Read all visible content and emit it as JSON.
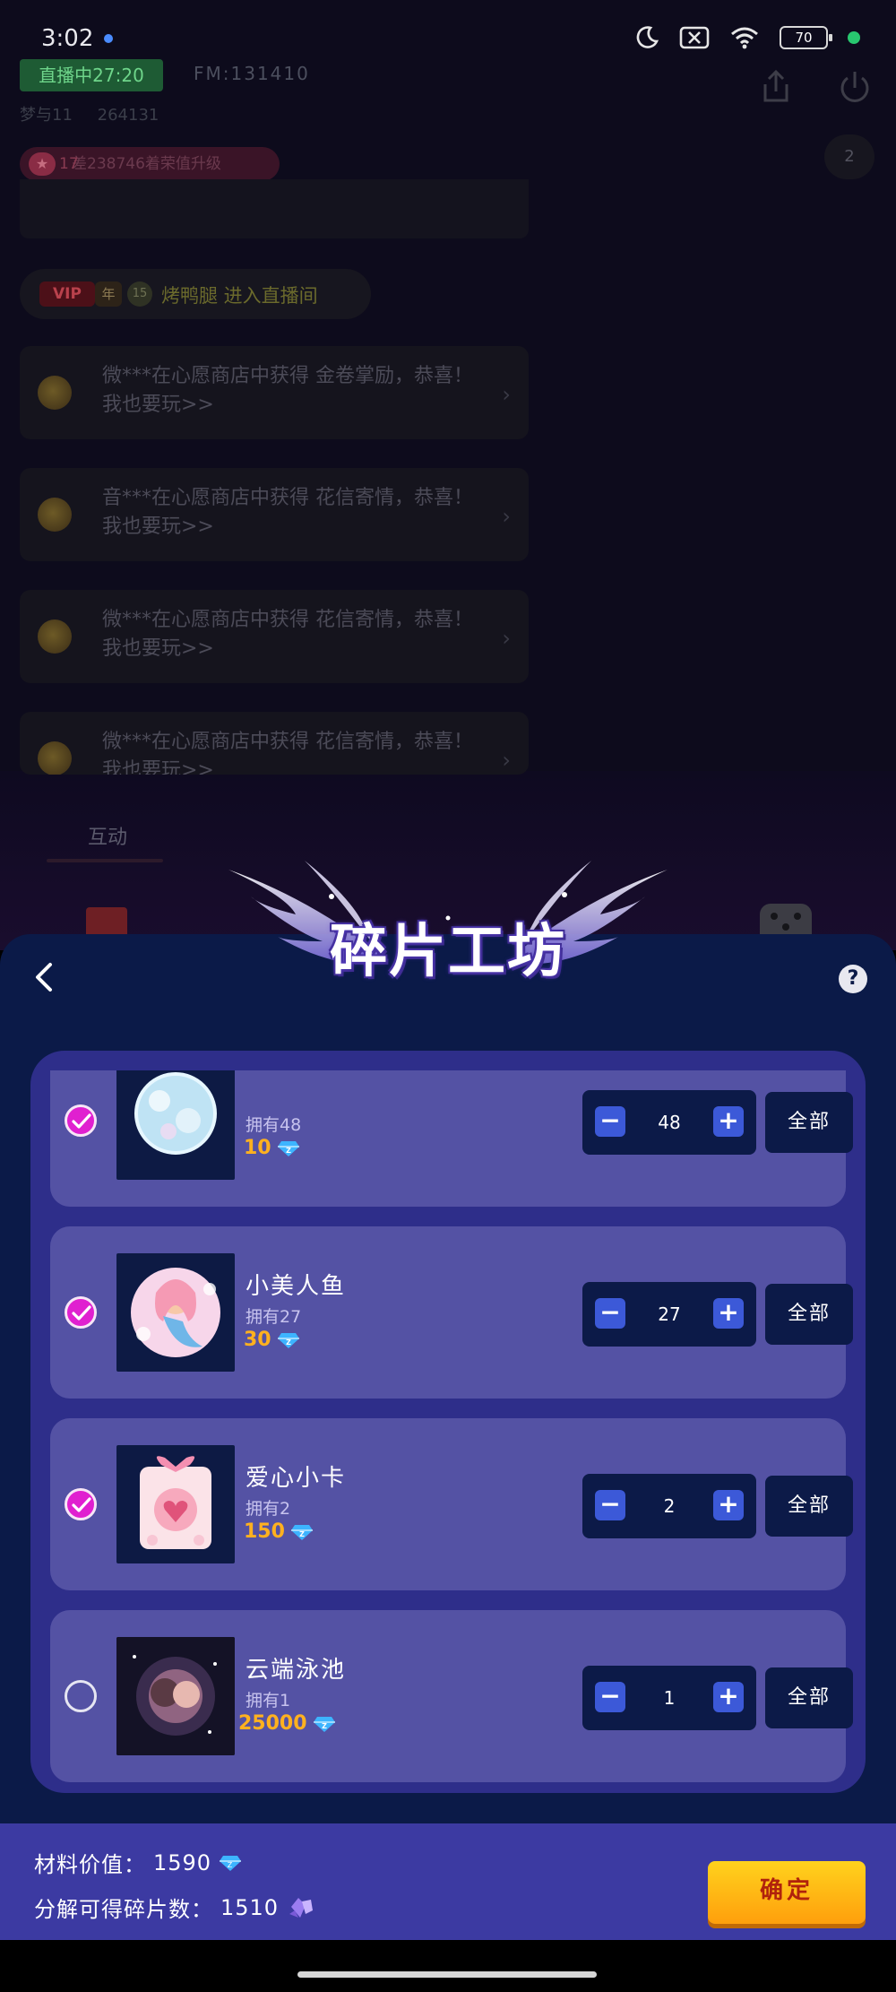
{
  "status_bar": {
    "time": "3:02",
    "battery": "70"
  },
  "room": {
    "live_badge": "直播中27:20",
    "fm": "FM:131410",
    "stats": [
      "梦与11",
      "264131"
    ],
    "share_icon": "share-icon",
    "power_icon": "power-icon",
    "viewer_count": "2",
    "rank_level": "17",
    "rank_text": "差238746着荣值升级",
    "vip_tag": "VIP",
    "vip_year": "年",
    "vip_level": "15",
    "vip_enter": "烤鸭腿 进入直播间",
    "messages": [
      "微***在心愿商店中获得 金卷掌励，恭喜！我也要玩>>",
      "音***在心愿商店中获得 花信寄情，恭喜！我也要玩>>",
      "微***在心愿商店中获得 花信寄情，恭喜！我也要玩>>",
      "微***在心愿商店中获得 花信寄情，恭喜！我也要玩>>"
    ],
    "interact_label": "互动"
  },
  "sheet": {
    "title": "碎片工坊",
    "help": "?",
    "items": [
      {
        "name": "",
        "owned": "拥有48",
        "price": "10",
        "qty": "48",
        "checked": true
      },
      {
        "name": "小美人鱼",
        "owned": "拥有27",
        "price": "30",
        "qty": "27",
        "checked": true
      },
      {
        "name": "爱心小卡",
        "owned": "拥有2",
        "price": "150",
        "qty": "2",
        "checked": true
      },
      {
        "name": "云端泳池",
        "owned": "拥有1",
        "price": "25000",
        "qty": "1",
        "checked": false
      }
    ],
    "all_label": "全部",
    "minus": "−",
    "plus": "+",
    "material_value_label": "材料价值：",
    "material_value": "1590",
    "fragments_label": "分解可得碎片数：",
    "fragments": "1510",
    "confirm_label": "确定",
    "colors": {
      "accent_check": "#e020d0",
      "price": "#ffb11f",
      "panel": "#2e2e8a",
      "card": "#5452a4",
      "confirm": "#ffb812"
    }
  }
}
